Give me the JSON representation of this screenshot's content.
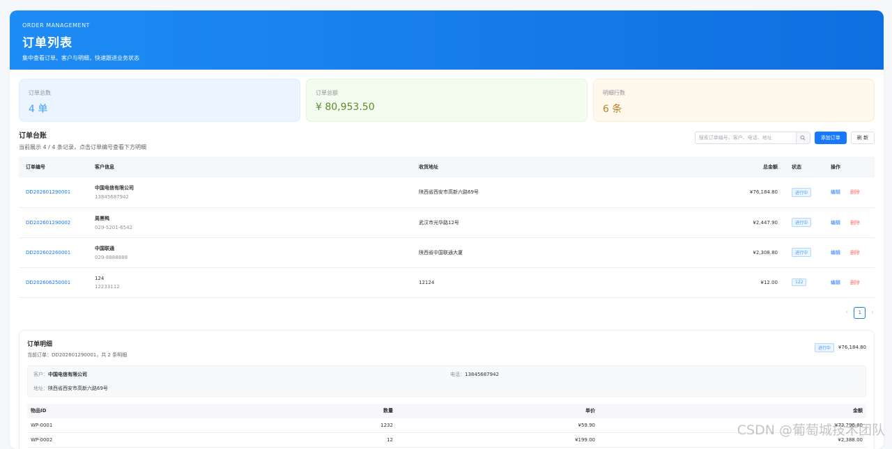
{
  "hero": {
    "eyebrow": "ORDER MANAGEMENT",
    "title": "订单列表",
    "subtitle": "集中查看订单、客户与明细，快速跟进业务状态"
  },
  "stats": [
    {
      "label": "订单总数",
      "value": "4 单"
    },
    {
      "label": "订单总额",
      "value": "¥ 80,953.50"
    },
    {
      "label": "明细行数",
      "value": "6 条"
    }
  ],
  "ledger": {
    "title": "订单台账",
    "subtitle": "当前展示 4 / 4 条记录，点击订单编号查看下方明细",
    "search_placeholder": "搜索订单编号、客户、电话、地址",
    "add_label": "添加订单",
    "refresh_label": "刷 新"
  },
  "orders_table": {
    "headers": [
      "订单编号",
      "客户信息",
      "收货地址",
      "总金额",
      "状态",
      "操作"
    ],
    "edit_label": "编辑",
    "delete_label": "删除",
    "rows": [
      {
        "id": "DD202601290001",
        "customer": "中国电信有限公司",
        "phone": "13845687942",
        "address": "陕西省西安市高新六路69号",
        "amount": "¥76,184.80",
        "status": "进行中"
      },
      {
        "id": "DD202601290002",
        "customer": "周黑鸭",
        "phone": "029-5201-6542",
        "address": "武汉市光华路12号",
        "amount": "¥2,447.90",
        "status": "进行中"
      },
      {
        "id": "DD202602260001",
        "customer": "中国联通",
        "phone": "029-8888888",
        "address": "陕西省中国联通大厦",
        "amount": "¥2,308.80",
        "status": "进行中"
      },
      {
        "id": "DD202606250001",
        "customer": "124",
        "phone": "12233112",
        "address": "12124",
        "amount": "¥12.00",
        "status": "122"
      }
    ]
  },
  "pagination": {
    "current": "1"
  },
  "detail": {
    "title": "订单明细",
    "subtitle": "当前订单：DD202601290001，共 2 条明细",
    "status": "进行中",
    "amount": "¥76,184.80",
    "customer_label": "客户：",
    "customer": "中国电信有限公司",
    "phone_label": "电话：",
    "phone": "13845687942",
    "address_label": "地址：",
    "address": "陕西省西安市高新六路69号",
    "headers": [
      "物品ID",
      "数量",
      "单价",
      "金额"
    ],
    "items": [
      {
        "id": "WP-0001",
        "qty": "1232",
        "price": "¥59.90",
        "amount": "¥73,796.80"
      },
      {
        "id": "WP-0002",
        "qty": "12",
        "price": "¥199.00",
        "amount": "¥2,388.00"
      }
    ]
  },
  "watermark": "CSDN @葡萄城技术团队",
  "colors": {
    "primary": "#1677ff",
    "danger": "#f56c6c",
    "hero_start": "#1e8cf5",
    "hero_end": "#0f6fe0"
  }
}
